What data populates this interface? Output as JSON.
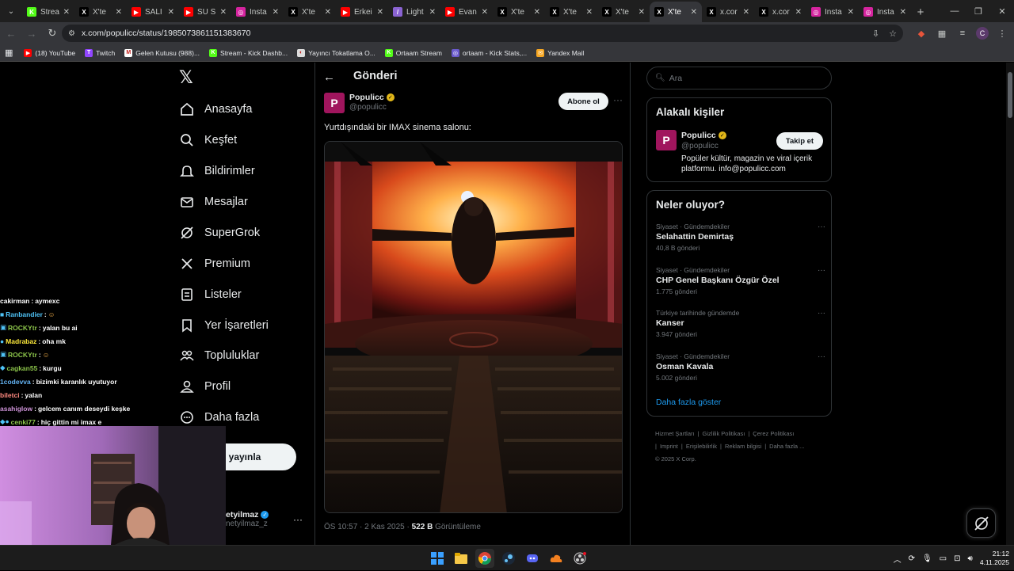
{
  "browser": {
    "tabs": [
      {
        "label": "Strea",
        "icon_color": "#53fc18",
        "icon_text": "K"
      },
      {
        "label": "X'te",
        "icon_color": "#000000",
        "icon_text": "X"
      },
      {
        "label": "SALI",
        "icon_color": "#ff0000",
        "icon_text": "▶"
      },
      {
        "label": "SU S",
        "icon_color": "#ff0000",
        "icon_text": "▶"
      },
      {
        "label": "Insta",
        "icon_color": "#d6249f",
        "icon_text": "◎"
      },
      {
        "label": "X'te",
        "icon_color": "#000000",
        "icon_text": "X"
      },
      {
        "label": "Erkei",
        "icon_color": "#ff0000",
        "icon_text": "▶"
      },
      {
        "label": "Light",
        "icon_color": "#8a63d2",
        "icon_text": "/"
      },
      {
        "label": "Evan",
        "icon_color": "#ff0000",
        "icon_text": "▶"
      },
      {
        "label": "X'te",
        "icon_color": "#000000",
        "icon_text": "X"
      },
      {
        "label": "X'te",
        "icon_color": "#000000",
        "icon_text": "X"
      },
      {
        "label": "X'te",
        "icon_color": "#000000",
        "icon_text": "X"
      },
      {
        "label": "X'te",
        "icon_color": "#000000",
        "icon_text": "X",
        "active": true
      },
      {
        "label": "x.cor",
        "icon_color": "#000000",
        "icon_text": "X"
      },
      {
        "label": "x.cor",
        "icon_color": "#000000",
        "icon_text": "X"
      },
      {
        "label": "Insta",
        "icon_color": "#d6249f",
        "icon_text": "◎"
      },
      {
        "label": "Insta",
        "icon_color": "#d6249f",
        "icon_text": "◎"
      }
    ],
    "url": "x.com/populicc/status/1985073861151383670",
    "bookmarks": [
      {
        "label": "(18) YouTube",
        "icon_color": "#ff0000",
        "icon_text": "▶"
      },
      {
        "label": "Twitch",
        "icon_color": "#9146ff",
        "icon_text": "T"
      },
      {
        "label": "Gelen Kutusu (988)...",
        "icon_color": "#ffffff",
        "icon_text": "M"
      },
      {
        "label": "Stream - Kick Dashb...",
        "icon_color": "#53fc18",
        "icon_text": "K"
      },
      {
        "label": "Yayıncı Tokatlama O...",
        "icon_color": "#dddddd",
        "icon_text": "◐"
      },
      {
        "label": "Ortaam Stream",
        "icon_color": "#53fc18",
        "icon_text": "K"
      },
      {
        "label": "ortaam - Kick Stats,...",
        "icon_color": "#6a5acd",
        "icon_text": "◎"
      },
      {
        "label": "Yandex Mail",
        "icon_color": "#f5a623",
        "icon_text": "✉"
      }
    ]
  },
  "nav": {
    "items": [
      {
        "label": "Anasayfa",
        "icon": "home-icon"
      },
      {
        "label": "Keşfet",
        "icon": "search-icon"
      },
      {
        "label": "Bildirimler",
        "icon": "bell-icon"
      },
      {
        "label": "Mesajlar",
        "icon": "mail-icon"
      },
      {
        "label": "SuperGrok",
        "icon": "grok-icon"
      },
      {
        "label": "Premium",
        "icon": "x-icon"
      },
      {
        "label": "Listeler",
        "icon": "list-icon"
      },
      {
        "label": "Yer İşaretleri",
        "icon": "bookmark-icon"
      },
      {
        "label": "Topluluklar",
        "icon": "community-icon"
      },
      {
        "label": "Profil",
        "icon": "profile-icon"
      },
      {
        "label": "Daha fazla",
        "icon": "more-circle-icon"
      }
    ],
    "post_button": "eri yayınla",
    "account_name": "etyilmaz",
    "account_handle": "netyilmaz_z"
  },
  "post": {
    "page_title": "Gönderi",
    "author_name": "Populicc",
    "author_handle": "@populicc",
    "avatar_letter": "P",
    "subscribe_label": "Abone ol",
    "text": "Yurtdışındaki bir IMAX sinema salonu:",
    "time": "ÖS 10:57 · 2 Kas 2025 · ",
    "views_count": "522 B",
    "views_label": " Görüntüleme"
  },
  "right": {
    "search_placeholder": "Ara",
    "relevant": {
      "title": "Alakalı kişiler",
      "name": "Populicc",
      "handle": "@populicc",
      "follow_label": "Takip et",
      "bio": "Popüler kültür, magazin ve viral içerik platformu. info@populicc.com"
    },
    "trends_title": "Neler oluyor?",
    "trends": [
      {
        "category": "Siyaset · Gündemdekiler",
        "name": "Selahattin Demirtaş",
        "count": "40,8 B gönderi"
      },
      {
        "category": "Siyaset · Gündemdekiler",
        "name": "CHP Genel Başkanı Özgür Özel",
        "count": "1.775 gönderi"
      },
      {
        "category": "Türkiye tarihinde gündemde",
        "name": "Kanser",
        "count": "3.947 gönderi"
      },
      {
        "category": "Siyaset · Gündemdekiler",
        "name": "Osman Kavala",
        "count": "5.002 gönderi"
      }
    ],
    "show_more": "Daha fazla göster",
    "footer": [
      "Hizmet Şartları",
      "|",
      "Gizlilik Politikası",
      "|",
      "Çerez Politikası",
      "|",
      "Imprint",
      "|",
      "Erişilebilirlik",
      "|",
      "Reklam bilgisi",
      "|",
      "Daha fazla ...",
      "© 2025 X Corp."
    ]
  },
  "chat": [
    {
      "user": "cakirman",
      "color": "#ffffff",
      "msg": "aymexc",
      "badge": ""
    },
    {
      "user": "Ranbandier",
      "color": "#4fc3f7",
      "msg": "",
      "badge": "■"
    },
    {
      "user": "ROCKYtr",
      "color": "#8bc34a",
      "msg": "yalan bu ai",
      "badge": "▣"
    },
    {
      "user": "Madrabaz",
      "color": "#ffeb3b",
      "msg": "oha mk",
      "badge": "●"
    },
    {
      "user": "ROCKYtr",
      "color": "#8bc34a",
      "msg": "",
      "badge": "▣"
    },
    {
      "user": "cagkan55",
      "color": "#8bc34a",
      "msg": "kurgu",
      "badge": "◆"
    },
    {
      "user": "1codevva",
      "color": "#64b5f6",
      "msg": "bizimki karanlık uyutuyor",
      "badge": ""
    },
    {
      "user": "biletci",
      "color": "#ff8a80",
      "msg": "yalan",
      "badge": ""
    },
    {
      "user": "asahiglow",
      "color": "#ce93d8",
      "msg": "gelcem canım deseydi keşke",
      "badge": ""
    },
    {
      "user": "cenki77",
      "color": "#8bc34a",
      "msg": "hiç gittin mi imax e",
      "badge": "◆●"
    }
  ],
  "taskbar": {
    "time": "21:12",
    "date": "4.11.2025"
  }
}
